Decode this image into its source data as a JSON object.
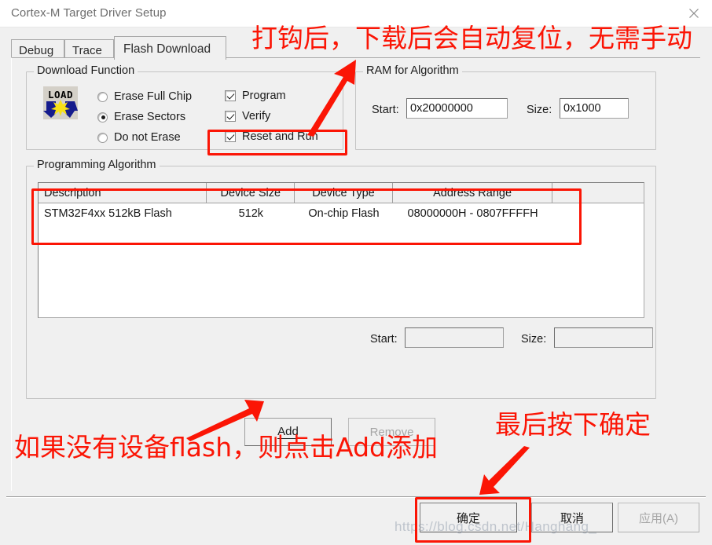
{
  "window": {
    "title": "Cortex-M Target Driver Setup",
    "close_icon": "close-icon"
  },
  "tabs": [
    {
      "label": "Debug",
      "active": false
    },
    {
      "label": "Trace",
      "active": false
    },
    {
      "label": "Flash Download",
      "active": true
    }
  ],
  "download_function": {
    "legend": "Download Function",
    "icon": "load-icon",
    "erase_mode": {
      "selected": "Erase Sectors",
      "options": [
        {
          "label": "Erase Full Chip",
          "checked": false
        },
        {
          "label": "Erase Sectors",
          "checked": true
        },
        {
          "label": "Do not Erase",
          "checked": false
        }
      ]
    },
    "checkboxes": [
      {
        "label": "Program",
        "checked": true
      },
      {
        "label": "Verify",
        "checked": true
      },
      {
        "label": "Reset and Run",
        "checked": true
      }
    ]
  },
  "ram_for_algorithm": {
    "legend": "RAM for Algorithm",
    "start_label": "Start:",
    "start_value": "0x20000000",
    "size_label": "Size:",
    "size_value": "0x1000"
  },
  "programming_algorithm": {
    "legend": "Programming Algorithm",
    "columns": [
      "Description",
      "Device Size",
      "Device Type",
      "Address Range"
    ],
    "rows": [
      {
        "description": "STM32F4xx 512kB Flash",
        "device_size": "512k",
        "device_type": "On-chip Flash",
        "address_range": "08000000H - 0807FFFFH"
      }
    ],
    "start_label": "Start:",
    "start_value": "",
    "size_label": "Size:",
    "size_value": ""
  },
  "actions": {
    "add_label": "Add",
    "remove_label": "Remove",
    "remove_disabled": true
  },
  "footer": {
    "ok_label": "确定",
    "cancel_label": "取消",
    "apply_label": "应用(A)",
    "apply_disabled": true
  },
  "annotations": {
    "top_note": "打钩后，下载后会自动复位，无需手动",
    "add_note": "如果没有设备flash，则点击Add添加",
    "ok_note": "最后按下确定",
    "highlight_color": "#fb1505"
  },
  "watermark": {
    "text": "https://blog.csdn.net/Hanghang_"
  }
}
